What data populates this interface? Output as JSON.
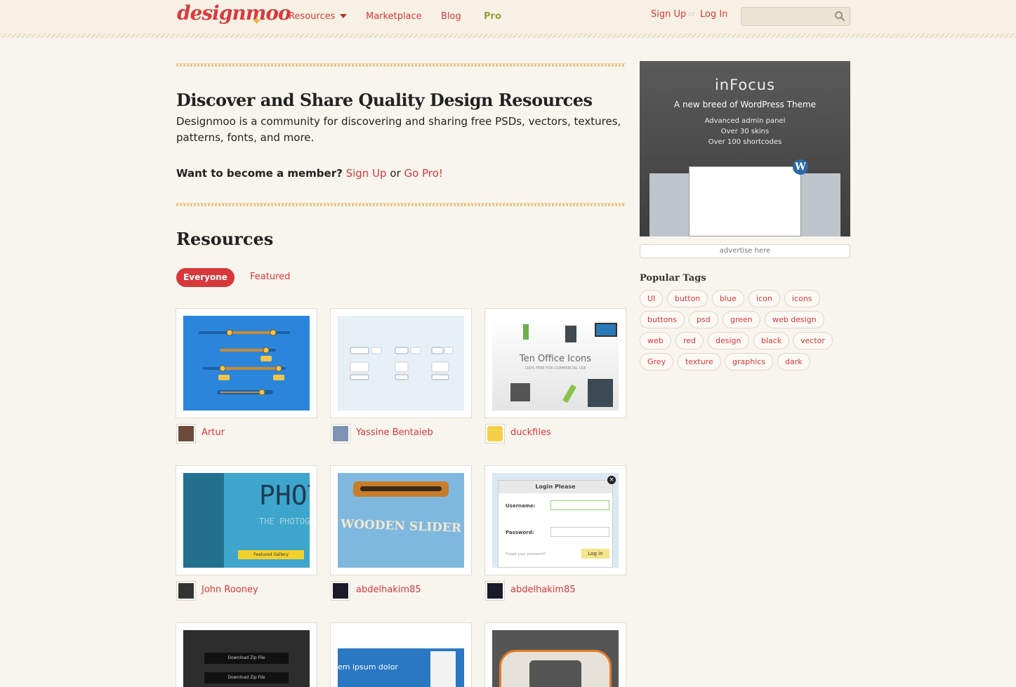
{
  "header": {
    "logo_text": "designmoo",
    "nav": {
      "resources": "Resources",
      "marketplace": "Marketplace",
      "blog": "Blog",
      "pro": "Pro"
    },
    "auth": {
      "signup": "Sign Up",
      "or": "or",
      "login": "Log In"
    },
    "search": {
      "placeholder": ""
    }
  },
  "hero": {
    "title": "Discover and Share Quality Design Resources",
    "description": "Designmoo is a community for discovering and sharing free PSDs, vectors, textures, patterns, fonts, and more.",
    "member_question": "Want to become a member?",
    "signup_link": "Sign Up",
    "or": "or",
    "gopro_link": "Go Pro!"
  },
  "resources": {
    "title": "Resources",
    "filters": {
      "everyone": "Everyone",
      "featured": "Featured"
    },
    "items": [
      {
        "owner": "Artur"
      },
      {
        "owner": "Yassine Bentaieb"
      },
      {
        "owner": "duckfiles",
        "thumb_title": "Ten Office Icons",
        "thumb_sub": "100% FREE FOR COMMERCIAL USE"
      },
      {
        "owner": "John Rooney",
        "thumb_title": "PHOT",
        "thumb_sub": "THE PHOTOG",
        "thumb_btn": "Featured Gallery"
      },
      {
        "owner": "abdelhakim85",
        "thumb_title": "WOODEN SLIDER"
      },
      {
        "owner": "abdelhakim85",
        "thumb_title": "Login Please",
        "username_label": "Username:",
        "password_label": "Password:",
        "forgot": "Forgot your password?",
        "login_btn": "Log in"
      },
      {
        "owner": "",
        "thumb_btn": "Download Zip File"
      },
      {
        "owner": "",
        "thumb_title": "em ipsum dolor"
      },
      {
        "owner": ""
      }
    ]
  },
  "sidebar": {
    "ad": {
      "title": "inFocus",
      "tagline": "A new breed of WordPress Theme",
      "features": [
        "Advanced admin panel",
        "Over 30 skins",
        "Over 100 shortcodes"
      ]
    },
    "advertise": "advertise here",
    "popular_tags_title": "Popular Tags",
    "tags": [
      "UI",
      "button",
      "blue",
      "icon",
      "icons",
      "buttons",
      "psd",
      "green",
      "web design",
      "web",
      "red",
      "design",
      "black",
      "vector",
      "Grey",
      "texture",
      "graphics",
      "dark"
    ]
  },
  "colors": {
    "background": "#f8f5ee",
    "accent": "#d6383c",
    "pro": "#8aa33c"
  }
}
